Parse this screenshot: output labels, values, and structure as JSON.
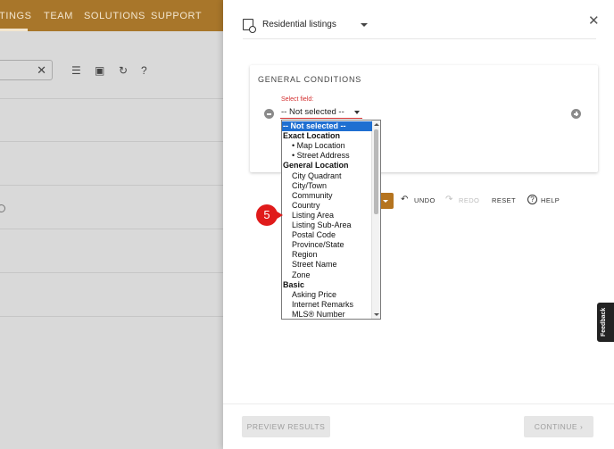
{
  "background_app": {
    "nav_items": [
      "TINGS",
      "TEAM",
      "SOLUTIONS",
      "SUPPORT"
    ]
  },
  "panel": {
    "header_title": "Residential listings",
    "section_heading": "GENERAL CONDITIONS",
    "select_label": "Select field:",
    "select_value": "-- Not selected --",
    "dropdown_items": [
      {
        "label": "-- Not selected --",
        "kind": "selected"
      },
      {
        "label": "Exact Location",
        "kind": "group"
      },
      {
        "label": "• Map Location",
        "kind": "opt2"
      },
      {
        "label": "• Street Address",
        "kind": "opt2"
      },
      {
        "label": "General Location",
        "kind": "group"
      },
      {
        "label": "City Quadrant",
        "kind": "opt"
      },
      {
        "label": "City/Town",
        "kind": "opt"
      },
      {
        "label": "Community",
        "kind": "opt"
      },
      {
        "label": "Country",
        "kind": "opt"
      },
      {
        "label": "Listing Area",
        "kind": "opt"
      },
      {
        "label": "Listing Sub-Area",
        "kind": "opt"
      },
      {
        "label": "Postal Code",
        "kind": "opt"
      },
      {
        "label": "Province/State",
        "kind": "opt"
      },
      {
        "label": "Region",
        "kind": "opt"
      },
      {
        "label": "Street Name",
        "kind": "opt"
      },
      {
        "label": "Zone",
        "kind": "opt"
      },
      {
        "label": "Basic",
        "kind": "group"
      },
      {
        "label": "Asking Price",
        "kind": "opt"
      },
      {
        "label": "Internet Remarks",
        "kind": "opt"
      },
      {
        "label": "MLS® Number",
        "kind": "opt"
      }
    ],
    "toolbar": {
      "undo": "UNDO",
      "redo": "REDO",
      "reset": "RESET",
      "help": "HELP"
    },
    "step_number": "5",
    "footer": {
      "preview": "PREVIEW RESULTS",
      "continue": "CONTINUE"
    },
    "feedback": "Feedback"
  },
  "colors": {
    "nav_bg": "#a8762a",
    "accent": "#b5741f",
    "selected": "#1f6fd1",
    "step_marker": "#e01b1b",
    "error": "#d32f2f"
  }
}
